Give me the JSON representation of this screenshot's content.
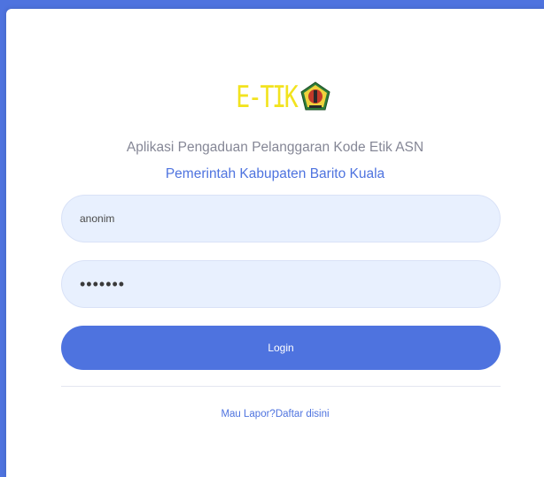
{
  "brand": {
    "logo_text": "E-TIK",
    "emblem_icon": "barito-kuala-emblem-icon"
  },
  "header": {
    "app_title": "Aplikasi Pengaduan Pelanggaran Kode Etik ASN",
    "organization": "Pemerintah Kabupaten Barito Kuala"
  },
  "form": {
    "username_value": "anonim",
    "password_value": "•••••••",
    "login_label": "Login"
  },
  "footer": {
    "register_link": "Mau Lapor?Daftar disini"
  },
  "colors": {
    "primary": "#4e73df",
    "logo_yellow": "#f2e31f",
    "input_bg": "#e8f0fe",
    "muted_text": "#858796"
  }
}
